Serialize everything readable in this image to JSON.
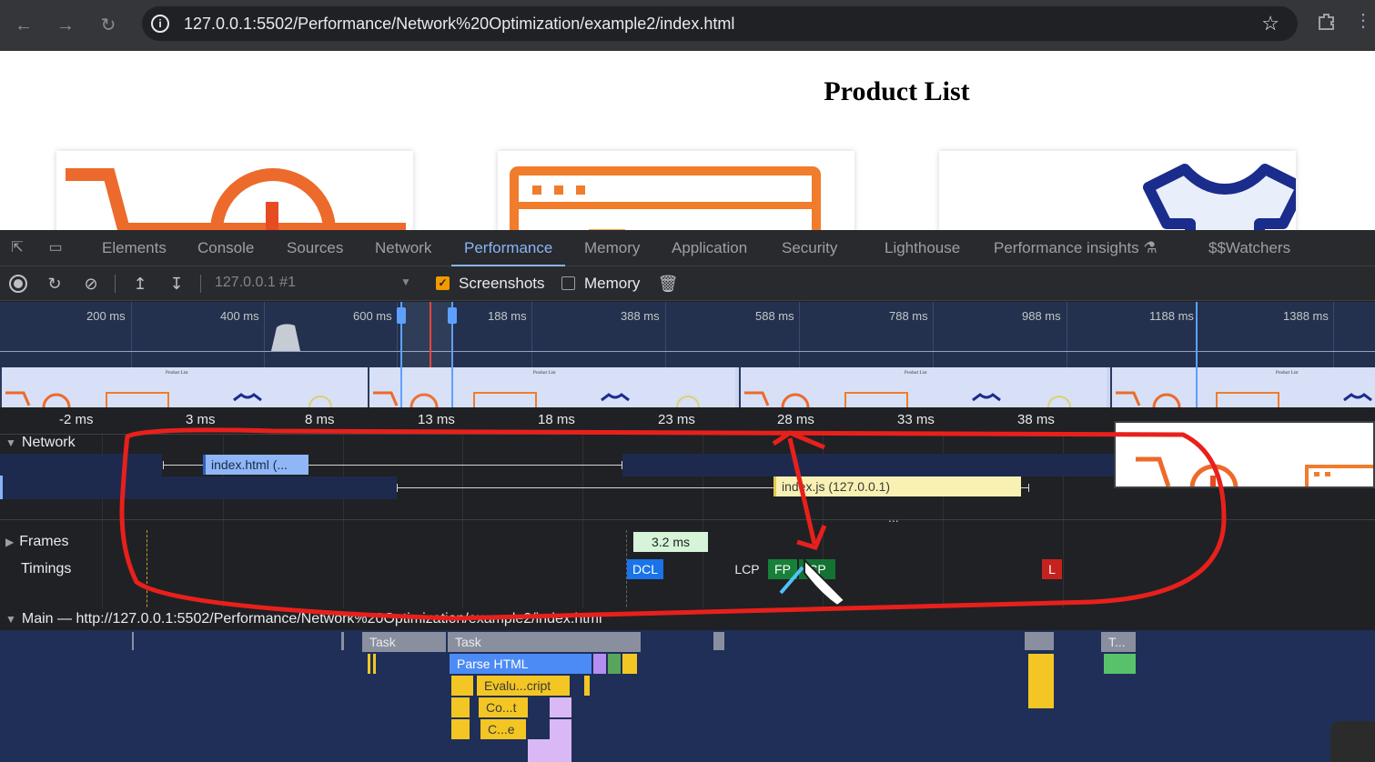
{
  "browser": {
    "url": "127.0.0.1:5502/Performance/Network%20Optimization/example2/index.html",
    "icons": [
      "back-arrow",
      "forward-arrow",
      "reload",
      "site-info",
      "bookmark-star",
      "extensions",
      "more"
    ]
  },
  "page": {
    "title": "Product List"
  },
  "devtools": {
    "tabs": [
      "Elements",
      "Console",
      "Sources",
      "Network",
      "Performance",
      "Memory",
      "Application",
      "Security",
      "Lighthouse",
      "Performance insights",
      "$$Watchers"
    ],
    "active_tab": "Performance",
    "toolbar": {
      "recording": "127.0.0.1 #1",
      "screenshots_label": "Screenshots",
      "screenshots_checked": true,
      "memory_label": "Memory",
      "memory_checked": false
    },
    "overview_labels": [
      "200 ms",
      "400 ms",
      "600 ms",
      "188 ms",
      "388 ms",
      "588 ms",
      "788 ms",
      "988 ms",
      "1188 ms",
      "1388 ms"
    ],
    "ruler_labels": [
      "-2 ms",
      "3 ms",
      "8 ms",
      "13 ms",
      "18 ms",
      "23 ms",
      "28 ms",
      "33 ms",
      "38 ms"
    ],
    "thumb_title": "Product List",
    "tracks": {
      "network": "Network",
      "frames": "Frames",
      "timings": "Timings",
      "main": "Main — http://127.0.0.1:5502/Performance/Network%20Optimization/example2/index.html"
    },
    "requests": {
      "html": "index.html (...",
      "js": "index.js (127.0.0.1)"
    },
    "ellipsis": "...",
    "frame_time": "3.2 ms",
    "markers": {
      "dcl": "DCL",
      "lcp": "LCP",
      "fp": "FP",
      "fcp": "CP",
      "load": "L"
    },
    "flame": {
      "task1": "Task",
      "task2": "Task",
      "task3": "T...",
      "parse": "Parse HTML",
      "eval": "Evalu...cript",
      "co": "Co...t",
      "ce": "C...e"
    },
    "colors": {
      "accent": "#8ab4f8",
      "annotation": "#e8201c",
      "dcl": "#1a73e8",
      "fp": "#188038",
      "load": "#c5221f"
    }
  }
}
